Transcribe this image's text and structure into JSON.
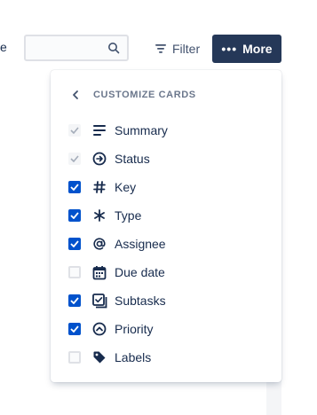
{
  "toolbar": {
    "partial_label": "e",
    "search": {
      "value": "",
      "placeholder": ""
    },
    "filter_label": "Filter",
    "more_label": "More",
    "more_dots": "•••"
  },
  "menu": {
    "title": "CUSTOMIZE CARDS",
    "options": [
      {
        "label": "Summary",
        "icon": "summary-icon",
        "state": "checked-disabled"
      },
      {
        "label": "Status",
        "icon": "status-icon",
        "state": "checked-disabled"
      },
      {
        "label": "Key",
        "icon": "hash-icon",
        "state": "checked"
      },
      {
        "label": "Type",
        "icon": "asterisk-icon",
        "state": "checked"
      },
      {
        "label": "Assignee",
        "icon": "at-icon",
        "state": "checked"
      },
      {
        "label": "Due date",
        "icon": "calendar-icon",
        "state": "unchecked"
      },
      {
        "label": "Subtasks",
        "icon": "subtasks-icon",
        "state": "checked"
      },
      {
        "label": "Priority",
        "icon": "priority-icon",
        "state": "checked"
      },
      {
        "label": "Labels",
        "icon": "tag-icon",
        "state": "unchecked"
      }
    ]
  },
  "colors": {
    "accent": "#0052cc",
    "more_button": "#253858",
    "text": "#172b4d",
    "muted": "#6b778c"
  }
}
